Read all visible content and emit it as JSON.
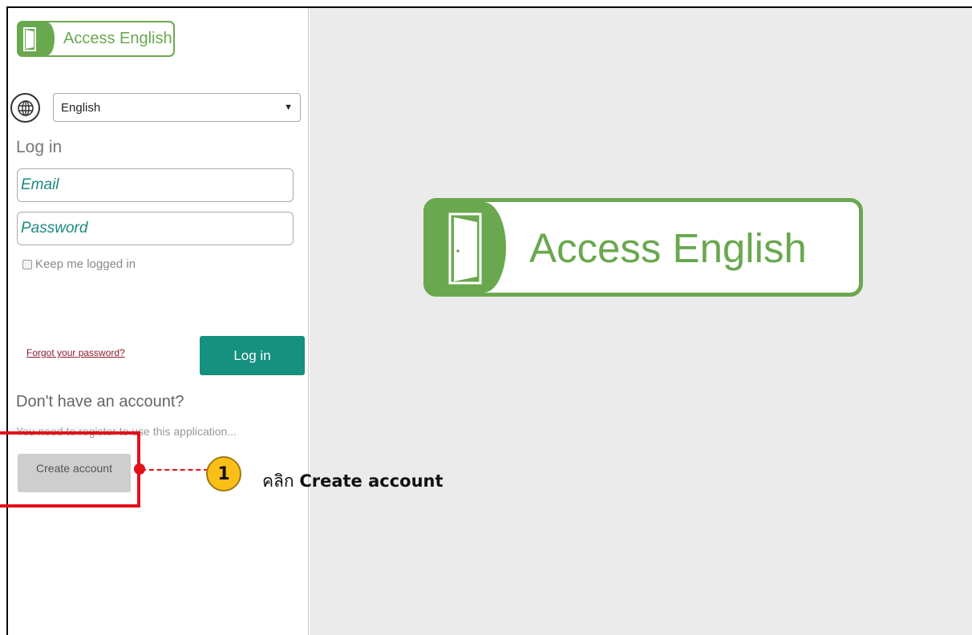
{
  "app": {
    "logo_text": "Access English",
    "large_logo_text": "Access English"
  },
  "language": {
    "icon": "globe-icon",
    "selected": "English"
  },
  "login": {
    "heading": "Log in",
    "email_placeholder": "Email",
    "password_placeholder": "Password",
    "keep_logged_in_label": "Keep me logged in",
    "keep_logged_in_checked": false,
    "forgot_link": "Forgot your password?",
    "login_button": "Log in"
  },
  "register": {
    "heading": "Don't have an account?",
    "note": "You need to register to use this application...",
    "create_button": "Create account"
  },
  "annotation": {
    "step_number": "1",
    "caption_verb": "คลิก",
    "caption_target": "Create account"
  },
  "colors": {
    "brand_green": "#6aa84f",
    "teal_button": "#16907f",
    "highlight_red": "#e3101b",
    "badge_yellow": "#fbbf18"
  }
}
